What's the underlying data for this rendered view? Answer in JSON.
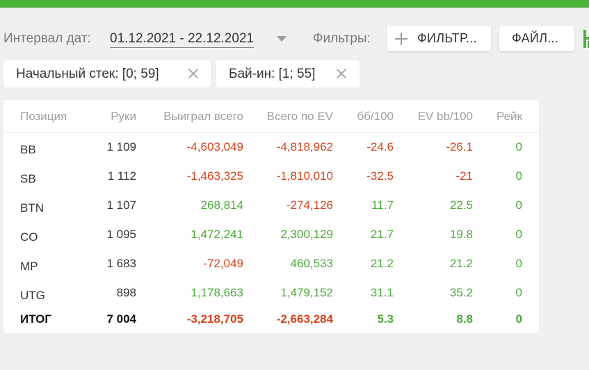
{
  "filters_bar": {
    "interval_label": "Интервал дат:",
    "date_range": "01.12.2021 - 22.12.2021",
    "filters_label": "Фильтры:",
    "filter_button": "ФИЛЬТР...",
    "file_button": "ФАЙЛ..."
  },
  "chips": [
    {
      "label": "Начальный стек: [0; 59]"
    },
    {
      "label": "Бай-ин: [1; 55]"
    }
  ],
  "table": {
    "headers": [
      "Позиция",
      "Руки",
      "Выиграл всего",
      "Всего по EV",
      "бб/100",
      "EV bb/100",
      "Рейк"
    ],
    "rows": [
      {
        "position": "BB",
        "hands": "1 109",
        "won": "-4,603,049",
        "ev": "-4,818,962",
        "bb100": "-24.6",
        "evbb100": "-26.1",
        "rake": "0"
      },
      {
        "position": "SB",
        "hands": "1 112",
        "won": "-1,463,325",
        "ev": "-1,810,010",
        "bb100": "-32.5",
        "evbb100": "-21",
        "rake": "0"
      },
      {
        "position": "BTN",
        "hands": "1 107",
        "won": "268,814",
        "ev": "-274,126",
        "bb100": "11.7",
        "evbb100": "22.5",
        "rake": "0"
      },
      {
        "position": "CO",
        "hands": "1 095",
        "won": "1,472,241",
        "ev": "2,300,129",
        "bb100": "21.7",
        "evbb100": "19.8",
        "rake": "0"
      },
      {
        "position": "MP",
        "hands": "1 683",
        "won": "-72,049",
        "ev": "460,533",
        "bb100": "21.2",
        "evbb100": "21.2",
        "rake": "0"
      },
      {
        "position": "UTG",
        "hands": "898",
        "won": "1,178,663",
        "ev": "1,479,152",
        "bb100": "31.1",
        "evbb100": "35.2",
        "rake": "0"
      }
    ],
    "total": {
      "position": "ИТОГ",
      "hands": "7 004",
      "won": "-3,218,705",
      "ev": "-2,663,284",
      "bb100": "5.3",
      "evbb100": "8.8",
      "rake": "0"
    }
  },
  "colors": {
    "accent": "#4bb33a",
    "negative": "#d6431c",
    "positive": "#4ba83a"
  }
}
